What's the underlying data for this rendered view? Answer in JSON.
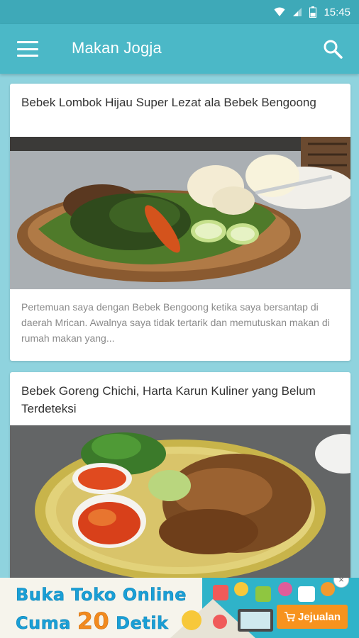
{
  "status_bar": {
    "time": "15:45",
    "icons": [
      "wifi-icon",
      "signal-icon",
      "battery-icon"
    ]
  },
  "app_bar": {
    "title": "Makan Jogja",
    "menu_icon": "hamburger-menu-icon",
    "search_icon": "search-icon"
  },
  "posts": [
    {
      "title": "Bebek Lombok Hijau Super Lezat ala Bebek Bengoong",
      "excerpt": "Pertemuan saya dengan Bebek Bengoong ketika saya bersantap di daerah Mrican. Awalnya saya tidak tertarik dan memutuskan makan di rumah makan yang..."
    },
    {
      "title": "Bebek Goreng Chichi, Harta Karun Kuliner yang Belum Terdeteksi",
      "excerpt": ""
    }
  ],
  "ad": {
    "line1": "Buka Toko Online",
    "line2_prefix": "Cuma",
    "line2_number": "20",
    "line2_suffix": "Detik",
    "brand": "Jejualan",
    "close_label": "×"
  },
  "colors": {
    "status_bar": "#3ea9b8",
    "app_bar": "#4bb8c7",
    "background": "#8fd3de",
    "card": "#ffffff",
    "title_text": "#333333",
    "excerpt_text": "#8a8a8a"
  }
}
